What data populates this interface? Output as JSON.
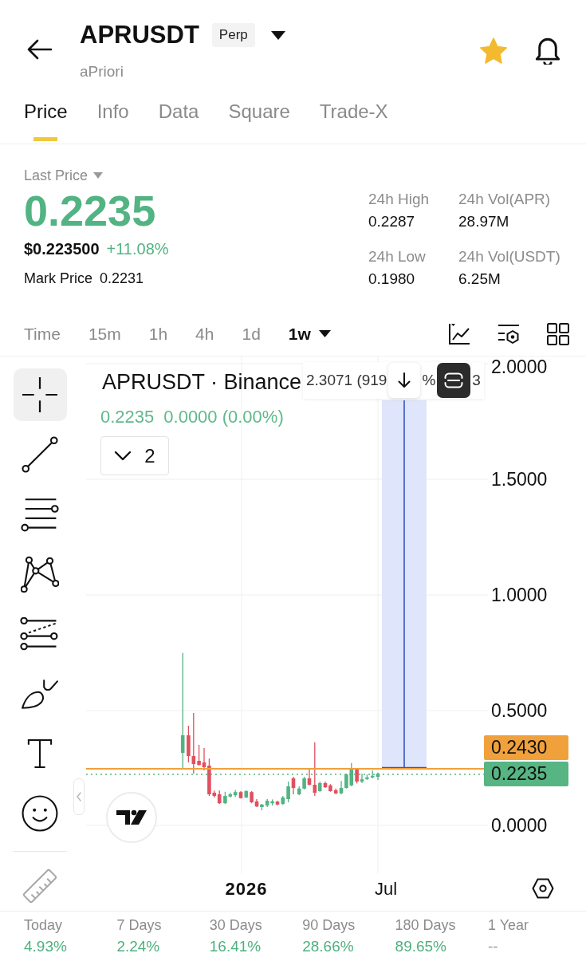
{
  "header": {
    "symbol": "APRUSDT",
    "badge": "Perp",
    "name": "aPriori",
    "favorite": true
  },
  "tabs": [
    {
      "label": "Price",
      "selected": true
    },
    {
      "label": "Info",
      "selected": false
    },
    {
      "label": "Data",
      "selected": false
    },
    {
      "label": "Square",
      "selected": false
    },
    {
      "label": "Trade-X",
      "selected": false
    }
  ],
  "ticker": {
    "last_price_label": "Last Price",
    "last_price": "0.2235",
    "usd_price": "$0.223500",
    "change": "+11.08%",
    "mark_price_label": "Mark Price",
    "mark_price": "0.2231",
    "stats": [
      {
        "label": "24h High",
        "value": "0.2287"
      },
      {
        "label": "24h Vol(APR)",
        "value": "28.97M"
      },
      {
        "label": "24h Low",
        "value": "0.1980"
      },
      {
        "label": "24h Vol(USDT)",
        "value": "6.25M"
      }
    ]
  },
  "intervals": [
    {
      "label": "Time",
      "selected": false,
      "dropdown": false
    },
    {
      "label": "15m",
      "selected": false,
      "dropdown": false
    },
    {
      "label": "1h",
      "selected": false,
      "dropdown": false
    },
    {
      "label": "4h",
      "selected": false,
      "dropdown": false
    },
    {
      "label": "1d",
      "selected": false,
      "dropdown": false
    },
    {
      "label": "1w",
      "selected": true,
      "dropdown": true
    }
  ],
  "drawing_tools": [
    {
      "kind": "crosshair",
      "selected": true
    },
    {
      "kind": "line",
      "selected": false
    },
    {
      "kind": "channel",
      "selected": false
    },
    {
      "kind": "pattern",
      "selected": false
    },
    {
      "kind": "fibonacci",
      "selected": false
    },
    {
      "kind": "brush",
      "selected": false
    },
    {
      "kind": "text",
      "selected": false
    },
    {
      "kind": "emoji",
      "selected": false
    }
  ],
  "footer_tools": [
    {
      "kind": "ruler",
      "selected": false
    }
  ],
  "chart": {
    "title": "APRUSDT · Binance",
    "legend_price": "0.2235",
    "legend_change": "0.0000 (0.00%)",
    "indicator_count": "2",
    "measure_label": [
      "2.3071 (919",
      "%",
      "3"
    ],
    "price_axis": [
      "2.0000",
      "1.5000",
      "1.0000",
      "0.5000",
      "0.0000"
    ],
    "price_tags": [
      {
        "value": "0.2430",
        "kind": "line",
        "color": "#f0a13c"
      },
      {
        "value": "0.2235",
        "kind": "last",
        "color": "#57b483"
      }
    ],
    "time_axis": [
      {
        "label": "2026",
        "kind": "year"
      },
      {
        "label": "Jul",
        "kind": "month"
      }
    ]
  },
  "performance": [
    {
      "label": "Today",
      "value": "4.93%",
      "kind": "up"
    },
    {
      "label": "7 Days",
      "value": "2.24%",
      "kind": "up"
    },
    {
      "label": "30 Days",
      "value": "16.41%",
      "kind": "up"
    },
    {
      "label": "90 Days",
      "value": "28.66%",
      "kind": "up"
    },
    {
      "label": "180 Days",
      "value": "89.65%",
      "kind": "up"
    },
    {
      "label": "1 Year",
      "value": "--",
      "kind": "flat"
    }
  ]
}
